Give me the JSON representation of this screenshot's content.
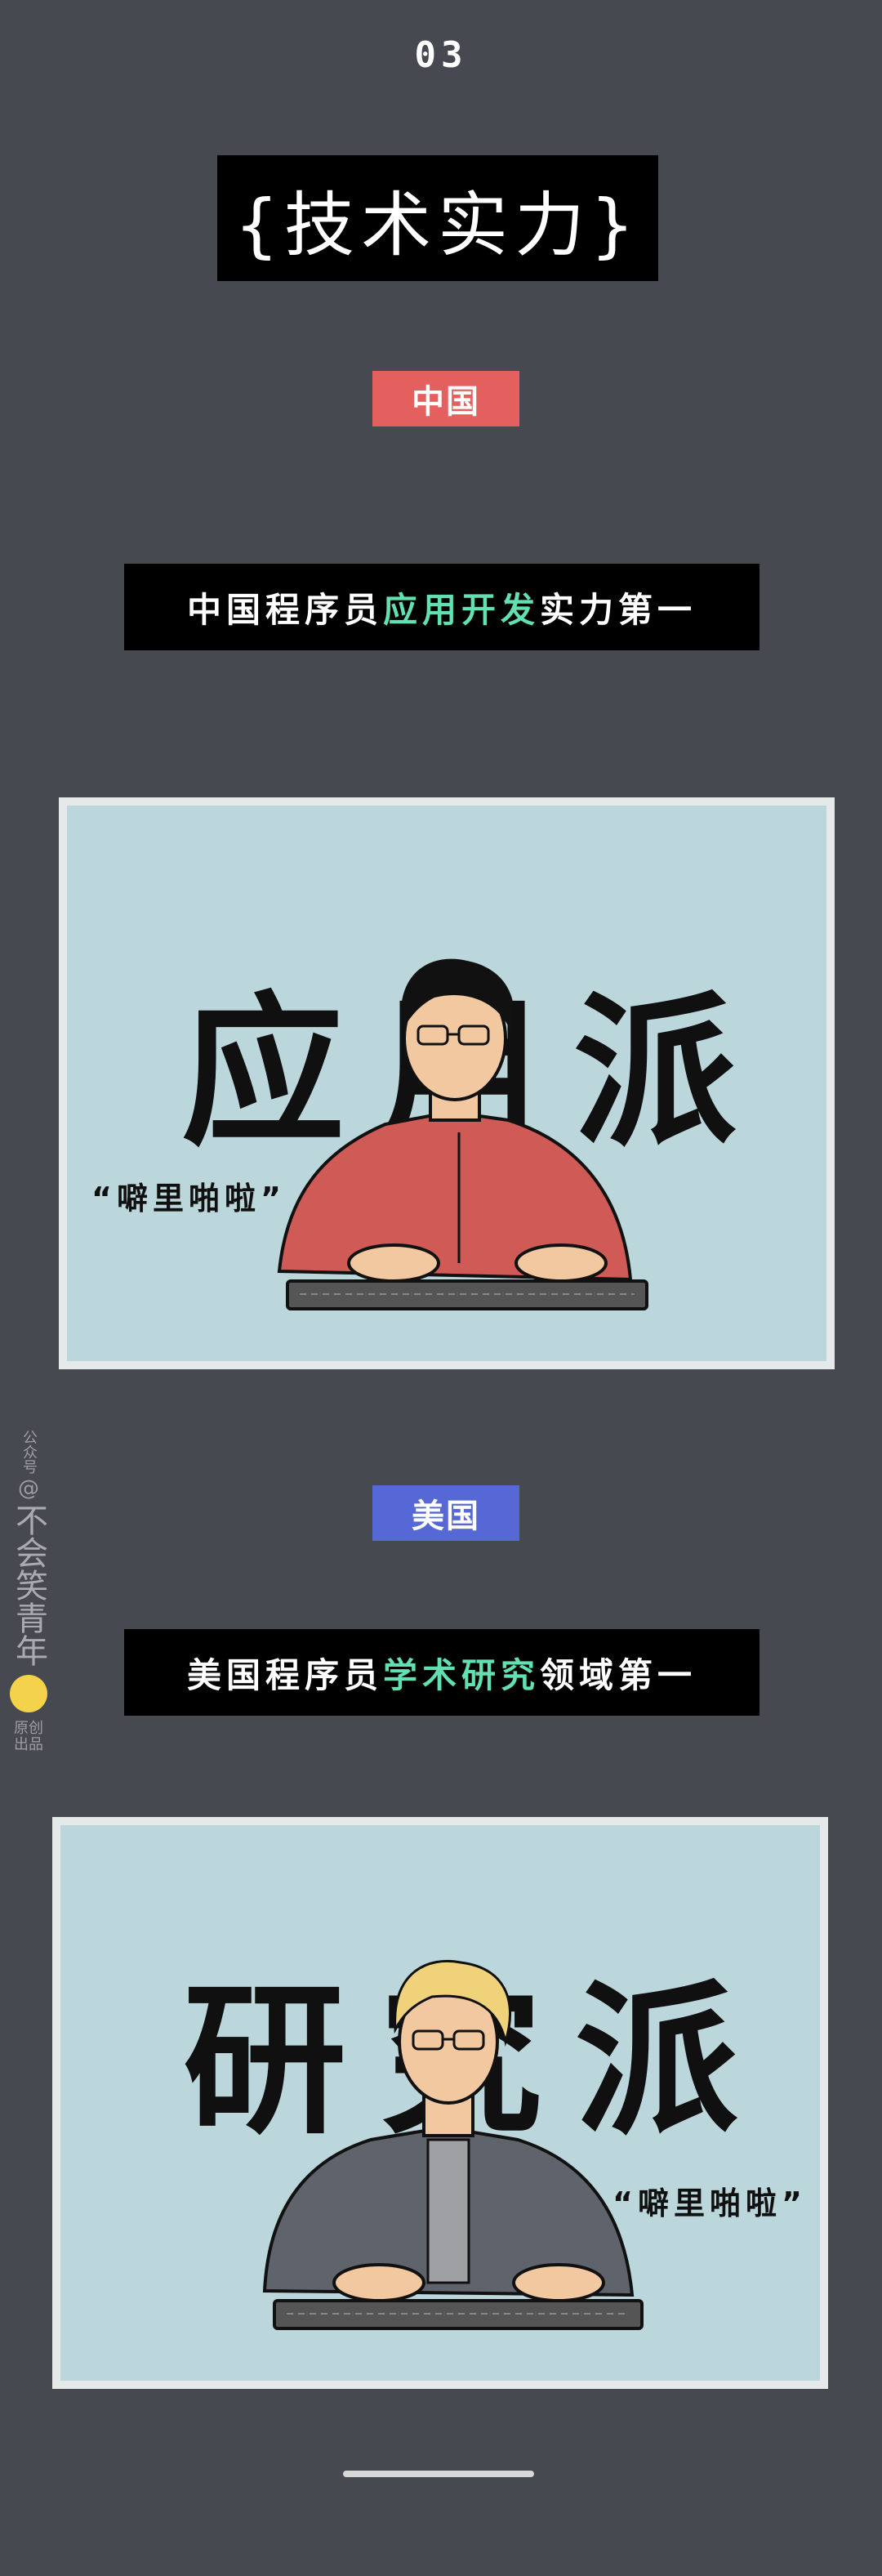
{
  "section_number": "03",
  "title": "{技术实力}",
  "china": {
    "tag": "中国",
    "banner": {
      "pre": "中国程序员",
      "highlight": "应用开发",
      "post": "实力第一"
    },
    "illustration_word": "应用派",
    "quote": "“噼里啪啦”"
  },
  "usa": {
    "tag": "美国",
    "banner": {
      "pre": "美国程序员",
      "highlight": "学术研究",
      "post": "领域第一"
    },
    "illustration_word": "研究派",
    "quote": "“噼里啪啦”"
  },
  "watermark": {
    "top": "公众号",
    "name": "不会笑青年",
    "bottom": "原创出品"
  },
  "colors": {
    "background": "#474950",
    "china_tag": "#e3605f",
    "usa_tag": "#5568d6",
    "highlight": "#62e0b0",
    "panel_bg": "#bbd7dc"
  }
}
